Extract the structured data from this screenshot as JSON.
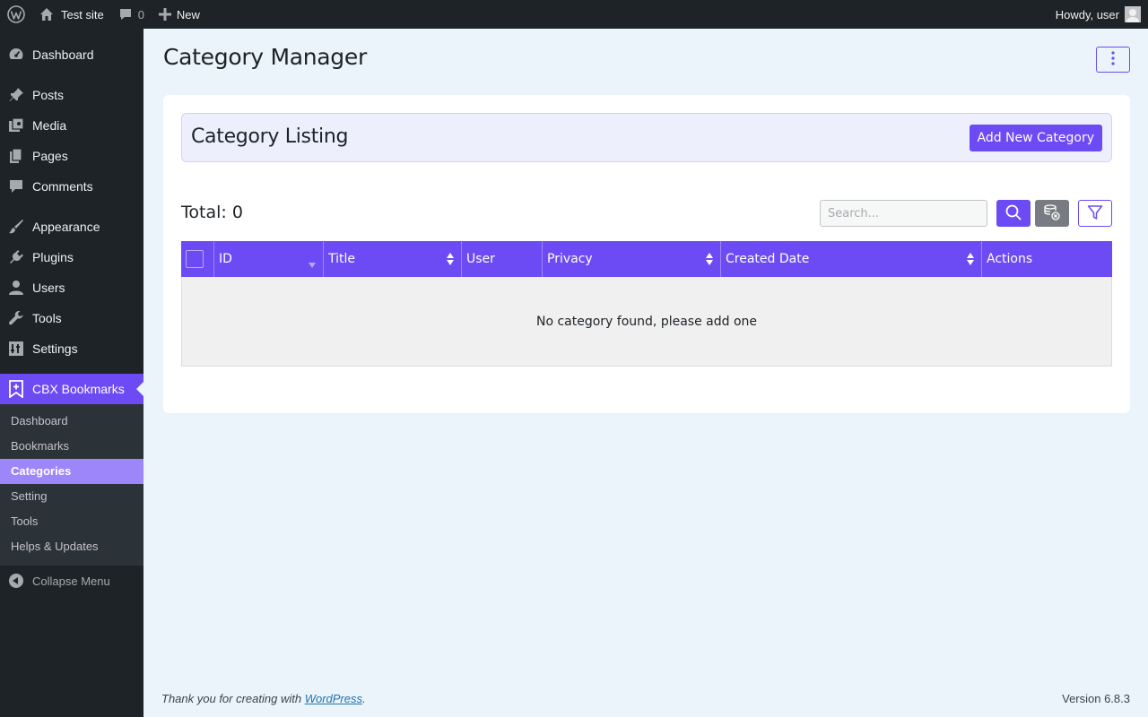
{
  "adminbar": {
    "site_name": "Test site",
    "comments_count": "0",
    "new_label": "New",
    "howdy": "Howdy, user"
  },
  "sidebar": {
    "items": [
      {
        "label": "Dashboard",
        "icon": "dashboard-icon"
      },
      {
        "label": "Posts",
        "icon": "pin-icon"
      },
      {
        "label": "Media",
        "icon": "media-icon"
      },
      {
        "label": "Pages",
        "icon": "pages-icon"
      },
      {
        "label": "Comments",
        "icon": "comment-icon"
      },
      {
        "label": "Appearance",
        "icon": "brush-icon"
      },
      {
        "label": "Plugins",
        "icon": "plugin-icon"
      },
      {
        "label": "Users",
        "icon": "user-icon"
      },
      {
        "label": "Tools",
        "icon": "wrench-icon"
      },
      {
        "label": "Settings",
        "icon": "settings-icon"
      },
      {
        "label": "CBX Bookmarks",
        "icon": "bookmark-icon"
      }
    ],
    "submenu": [
      "Dashboard",
      "Bookmarks",
      "Categories",
      "Setting",
      "Tools",
      "Helps & Updates"
    ],
    "collapse_label": "Collapse Menu"
  },
  "page": {
    "title": "Category Manager",
    "listing_title": "Category Listing",
    "add_button": "Add New Category",
    "total": "Total: 0",
    "search_placeholder": "Search...",
    "empty_message": "No category found, please add one"
  },
  "table": {
    "columns": [
      "ID",
      "Title",
      "User",
      "Privacy",
      "Created Date",
      "Actions"
    ]
  },
  "footer": {
    "thanks_prefix": "Thank you for creating with ",
    "link": "WordPress",
    "suffix": ".",
    "version": "Version 6.8.3"
  },
  "colors": {
    "accent": "#6c4bf5",
    "admin_dark": "#1d2327",
    "background": "#eaf4fa"
  }
}
